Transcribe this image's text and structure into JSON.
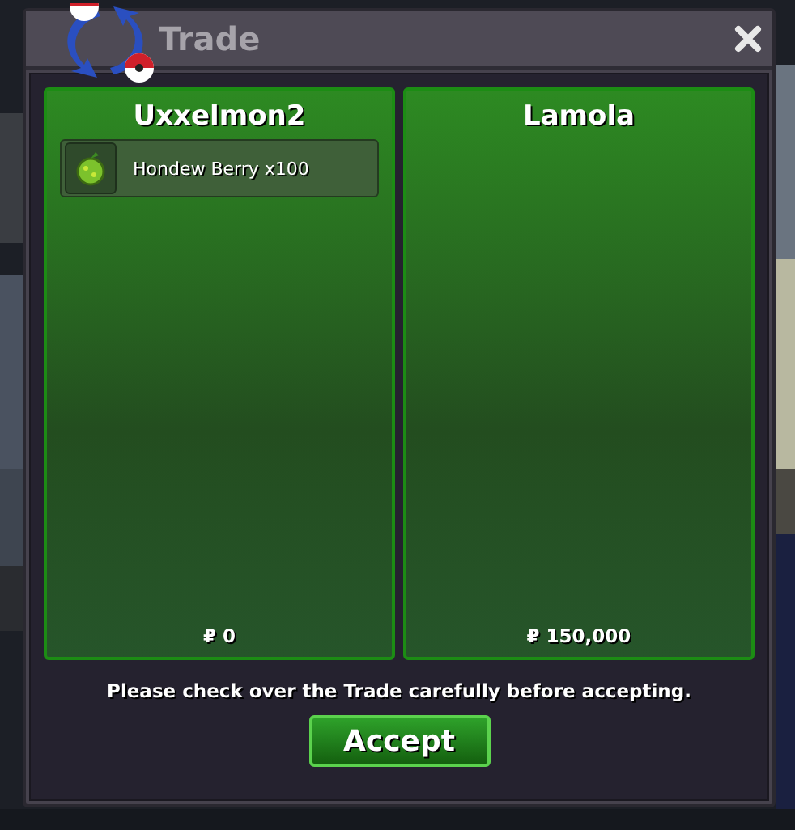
{
  "window": {
    "title": "Trade"
  },
  "sides": [
    {
      "name": "Uxxelmon2",
      "items": [
        {
          "label": "Hondew Berry x100"
        }
      ],
      "money": "₽ 0"
    },
    {
      "name": "Lamola",
      "money": "₽ 150,000"
    }
  ],
  "notice": "Please check over the Trade carefully before accepting.",
  "accept_button": "Accept"
}
